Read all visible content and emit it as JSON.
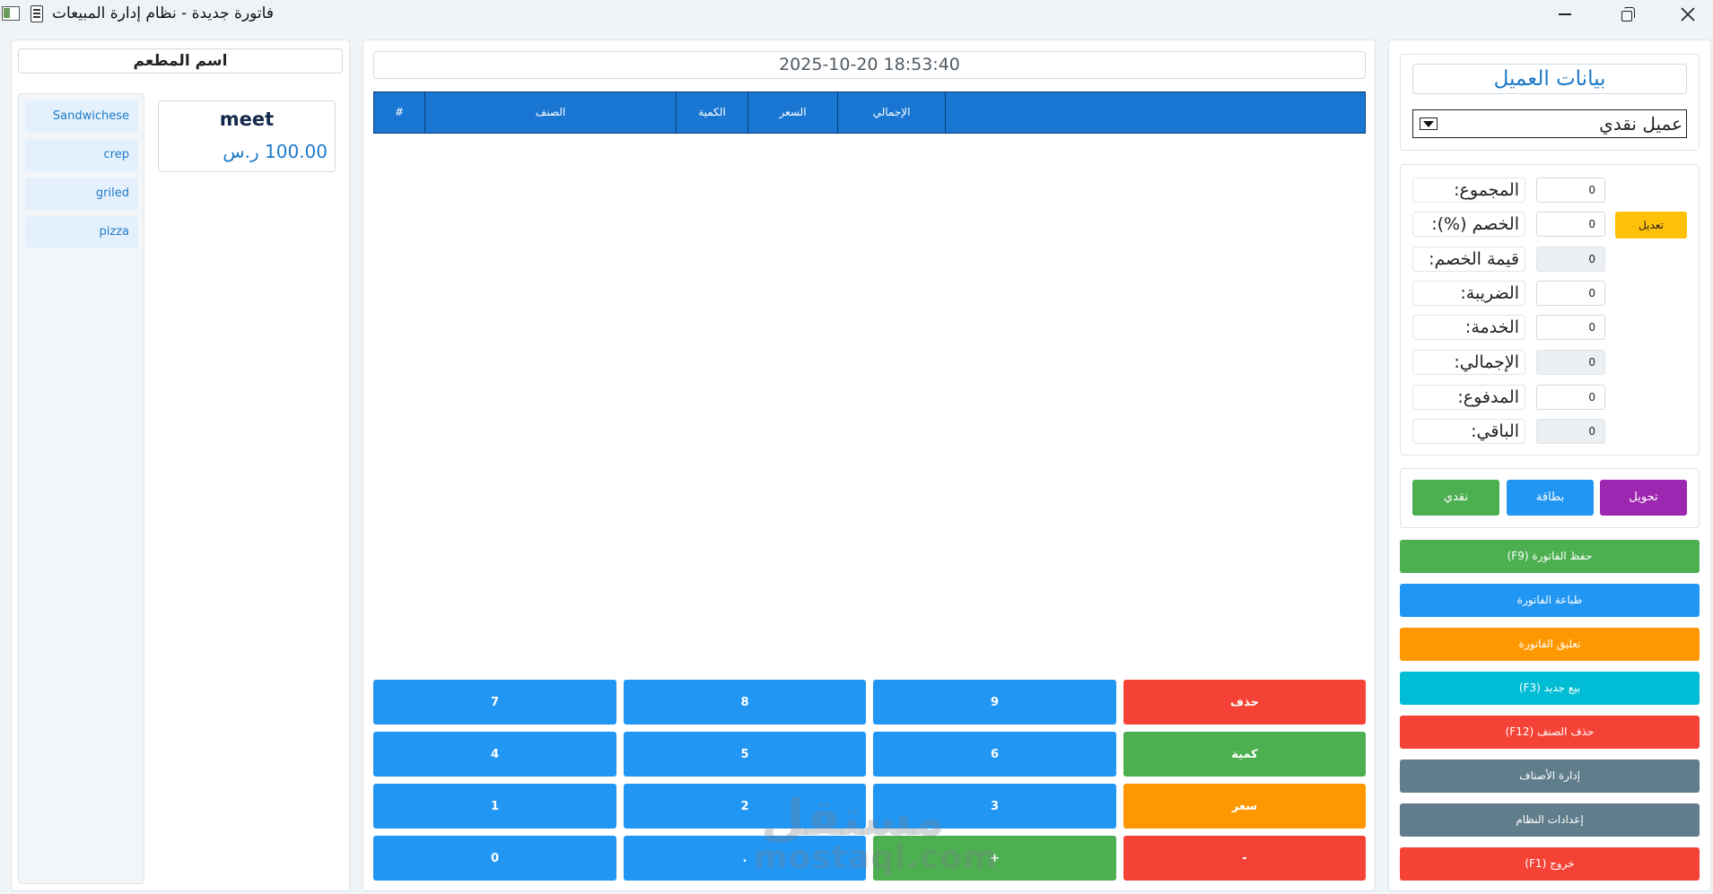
{
  "window": {
    "title": "فاتورة جديدة - نظام إدارة المبيعات"
  },
  "left": {
    "restaurant_name": "اسم المطعم",
    "categories": [
      "Sandwichese",
      "crep",
      "griled",
      "pizza"
    ],
    "product": {
      "name": "meet",
      "price": "100.00 ر.س"
    }
  },
  "invoice": {
    "datetime": "2025-10-20 18:53:40",
    "columns": [
      "#",
      "الصنف",
      "الكمية",
      "السعر",
      "الإجمالي",
      ""
    ],
    "rows": []
  },
  "keypad": {
    "row1": [
      "7",
      "8",
      "9",
      "حذف"
    ],
    "row2": [
      "4",
      "5",
      "6",
      "كمية"
    ],
    "row3": [
      "1",
      "2",
      "3",
      "سعر"
    ],
    "row4": [
      "0",
      ".",
      "+",
      "-"
    ]
  },
  "customer": {
    "title": "بيانات العميل",
    "selected": "عميل نقدي"
  },
  "summary": {
    "total_label": "المجموع:",
    "total_value": "0",
    "discount_pct_label": "الخصم (%):",
    "discount_pct_value": "0",
    "discount_amount_label": "قيمة الخصم:",
    "discount_amount_value": "0",
    "tax_label": "الضريبة:",
    "tax_value": "0",
    "service_label": "الخدمة:",
    "service_value": "0",
    "grand_total_label": "الإجمالي:",
    "grand_total_value": "0",
    "paid_label": "المدفوع:",
    "paid_value": "0",
    "remaining_label": "الباقي:",
    "remaining_value": "0",
    "edit_label": "تعديل"
  },
  "payment": {
    "transfer": "تحويل",
    "card": "بطاقة",
    "cash": "نقدي"
  },
  "actions": {
    "save": "(F9) حفظ الفاتورة",
    "print": "طباعة الفاتورة",
    "hold": "تعليق الفاتورة",
    "new_sale": "(F3) بيع جديد",
    "delete_item": "(F12) حذف الصنف",
    "manage_items": "إدارة الأصناف",
    "settings": "إعدادات النظام",
    "exit": "(F1) خروج"
  },
  "watermark": {
    "arabic": "مستقل",
    "latin": "mostaql.com"
  },
  "colors": {
    "blue": "#2196f3",
    "header_blue": "#1976d2",
    "green": "#4caf50",
    "orange": "#ff9800",
    "red": "#f44336",
    "purple": "#9c27b0",
    "cyan": "#00bcd4",
    "slate": "#607d8b",
    "yellow": "#ffc107"
  }
}
